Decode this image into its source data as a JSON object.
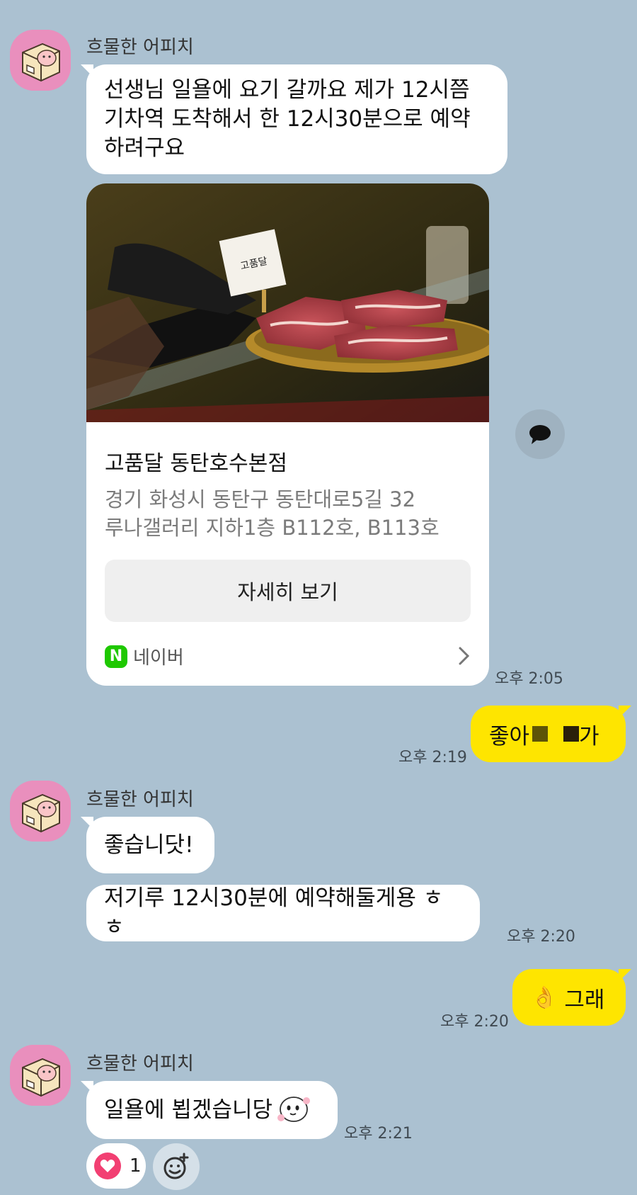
{
  "peer": {
    "name": "흐물한 어피치"
  },
  "messages": {
    "m1": {
      "text": "선생님 일욜에 요기 갈까요 제가 12시쯤 기차역 도착해서 한 12시30분으로 예약하려구요"
    },
    "card": {
      "place_name": "고품달 동탄호수본점",
      "address_line1": "경기 화성시 동탄구 동탄대로5길 32",
      "address_line2": "루나갤러리 지하1층 B112호, B113호",
      "button_label": "자세히 보기",
      "source_label": "네이버",
      "source_badge": "N",
      "time": "오후 2:05",
      "image_sign_text": "고품달"
    },
    "m2": {
      "text_before": "좋아",
      "text_after": "가",
      "time": "오후 2:19"
    },
    "m3": {
      "text": "좋습니닷!"
    },
    "m4": {
      "text": "저기루 12시30분에 예약해둘게용 ㅎㅎ",
      "time": "오후 2:20"
    },
    "m5": {
      "emoji": "👌",
      "text": "그래",
      "time": "오후 2:20"
    },
    "m6": {
      "text": "일욜에 뵙겠습니당",
      "time": "오후 2:21"
    },
    "reaction": {
      "count": "1"
    }
  },
  "icons": {
    "avatar": "apeach-box-avatar",
    "share": "speech-bubble-icon",
    "heart": "heart-icon",
    "add_reaction": "add-emoji-icon",
    "chevron": "chevron-right-icon",
    "sticker": "ghost-emoticon"
  },
  "colors": {
    "background": "#abc1d1",
    "incoming_bubble": "#ffffff",
    "outgoing_bubble": "#fee500",
    "naver_green": "#1ec800",
    "heart": "#f23f72"
  }
}
